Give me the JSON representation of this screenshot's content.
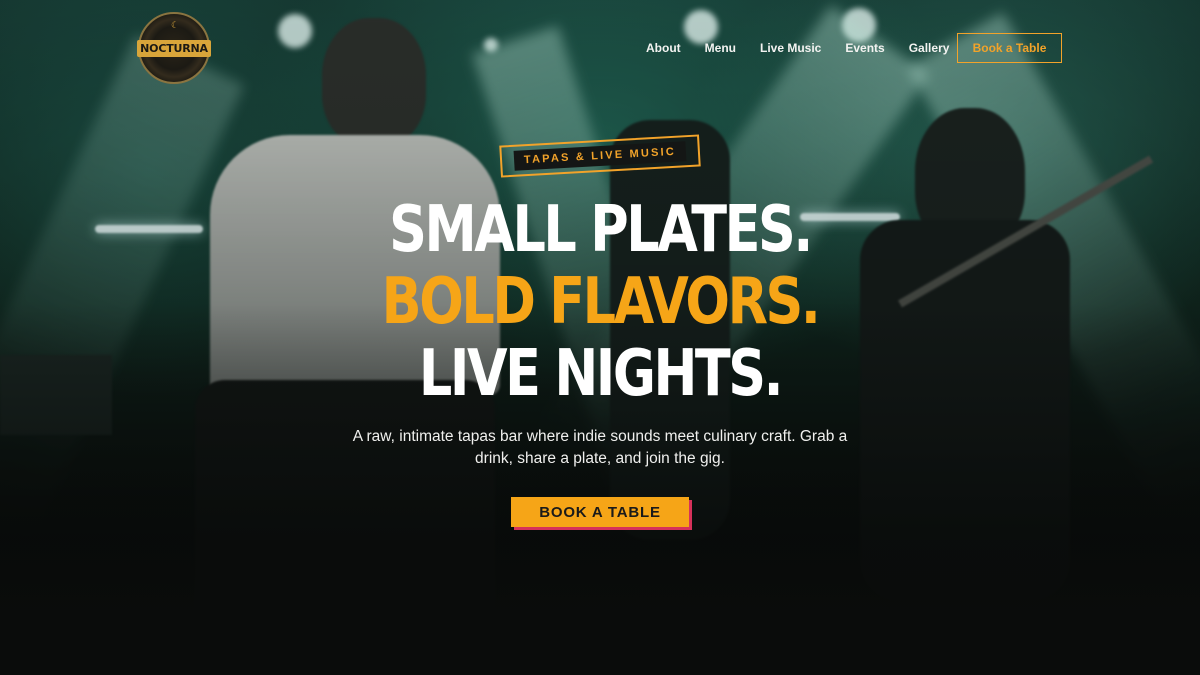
{
  "brand": {
    "name": "NOCTURNA"
  },
  "nav": {
    "items": [
      "About",
      "Menu",
      "Live Music",
      "Events",
      "Gallery"
    ],
    "cta_label": "Book a Table"
  },
  "hero": {
    "tag": "TAPAS & LIVE MUSIC",
    "headline_line1": "SMALL PLATES.",
    "headline_line2": "BOLD FLAVORS.",
    "headline_line3": "LIVE NIGHTS.",
    "subtitle": "A raw, intimate tapas bar where indie sounds meet culinary craft. Grab a drink, share a plate, and join the gig.",
    "cta_label": "BOOK A TABLE"
  },
  "colors": {
    "accent": "#f6a517",
    "cta_shadow": "#d6315a",
    "text": "#ffffff"
  }
}
